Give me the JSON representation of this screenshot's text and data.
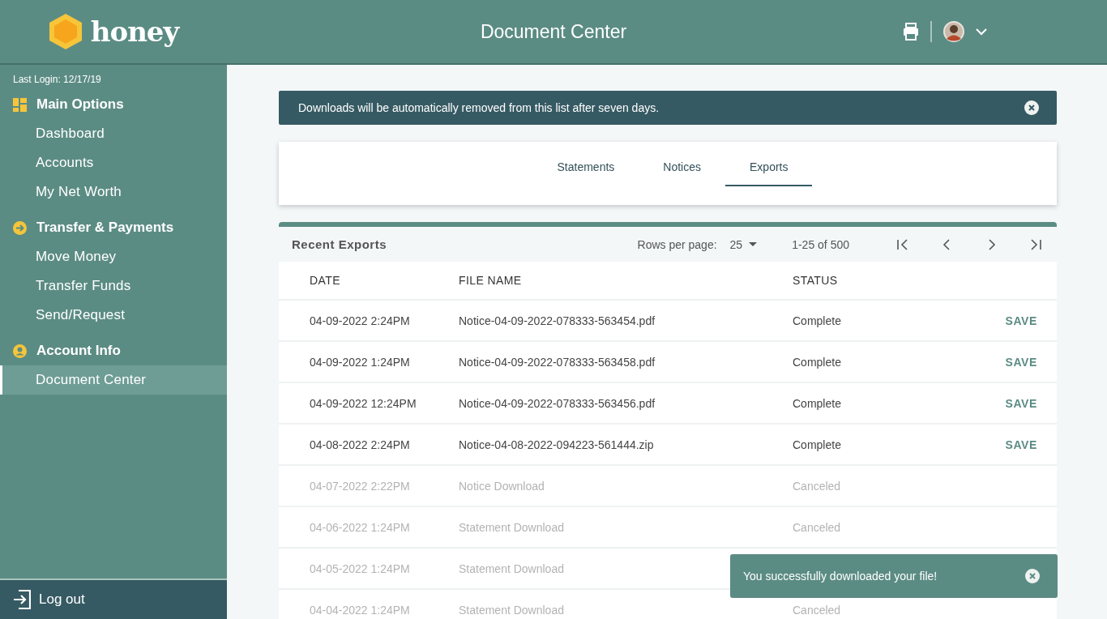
{
  "header": {
    "logo_text": "honey",
    "title": "Document Center"
  },
  "sidebar": {
    "last_login": "Last Login: 12/17/19",
    "sections": [
      {
        "title": "Main Options",
        "kind": "grid",
        "items": [
          {
            "label": "Dashboard",
            "selected": false
          },
          {
            "label": "Accounts",
            "selected": false
          },
          {
            "label": "My Net Worth",
            "selected": false
          }
        ]
      },
      {
        "title": "Transfer & Payments",
        "kind": "arrow",
        "items": [
          {
            "label": "Move Money",
            "selected": false
          },
          {
            "label": "Transfer Funds",
            "selected": false
          },
          {
            "label": "Send/Request",
            "selected": false
          }
        ]
      },
      {
        "title": "Account Info",
        "kind": "person",
        "items": [
          {
            "label": "Document Center",
            "selected": true
          }
        ]
      }
    ],
    "logout": "Log out"
  },
  "banner": {
    "text": "Downloads will be automatically removed from this list after seven days."
  },
  "tabs": [
    {
      "label": "Statements",
      "selected": false
    },
    {
      "label": "Notices",
      "selected": false
    },
    {
      "label": "Exports",
      "selected": true
    }
  ],
  "table": {
    "title": "Recent Exports",
    "rows_per_page_label": "Rows per page:",
    "rows_per_page": "25",
    "range": "1-25 of 500",
    "columns": [
      "DATE",
      "FILE NAME",
      "STATUS"
    ],
    "rows": [
      {
        "date": "04-09-2022 2:24PM",
        "file": "Notice-04-09-2022-078333-563454.pdf",
        "status": "Complete",
        "action": "SAVE",
        "disabled": false
      },
      {
        "date": "04-09-2022 1:24PM",
        "file": "Notice-04-09-2022-078333-563458.pdf",
        "status": "Complete",
        "action": "SAVE",
        "disabled": false
      },
      {
        "date": "04-09-2022 12:24PM",
        "file": "Notice-04-09-2022-078333-563456.pdf",
        "status": "Complete",
        "action": "SAVE",
        "disabled": false
      },
      {
        "date": "04-08-2022 2:24PM",
        "file": "Notice-04-08-2022-094223-561444.zip",
        "status": "Complete",
        "action": "SAVE",
        "disabled": false
      },
      {
        "date": "04-07-2022 2:22PM",
        "file": "Notice Download",
        "status": "Canceled",
        "disabled": true
      },
      {
        "date": "04-06-2022 1:24PM",
        "file": "Statement Download",
        "status": "Canceled",
        "disabled": true
      },
      {
        "date": "04-05-2022 1:24PM",
        "file": "Statement Download",
        "disabled": true
      },
      {
        "date": "04-04-2022 1:24PM",
        "file": "Statement Download",
        "status": "Canceled",
        "disabled": true
      }
    ]
  },
  "toast": {
    "text": "You successfully downloaded your file!"
  }
}
